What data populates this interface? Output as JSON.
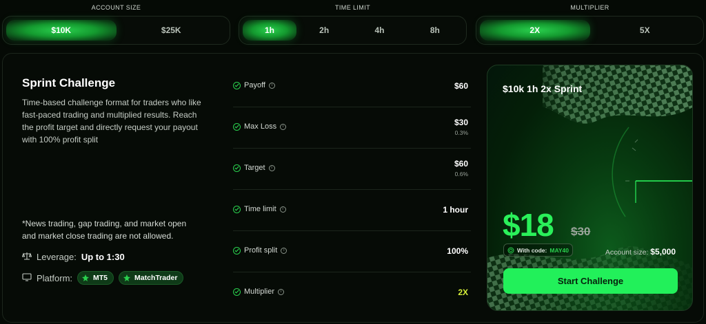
{
  "selectors": {
    "account_size": {
      "label": "ACCOUNT SIZE",
      "options": [
        "$10K",
        "$25K"
      ],
      "selected": "$10K"
    },
    "time_limit": {
      "label": "TIME LIMIT",
      "options": [
        "1h",
        "2h",
        "4h",
        "8h"
      ],
      "selected": "1h"
    },
    "multiplier": {
      "label": "MULTIPLIER",
      "options": [
        "2X",
        "5X"
      ],
      "selected": "2X"
    }
  },
  "challenge": {
    "title": "Sprint Challenge",
    "description": "Time-based challenge format for traders who like fast-paced trading and multiplied results. Reach the profit target and directly request your payout with 100% profit split",
    "note": "*News trading, gap trading, and market open and market close trading are not allowed.",
    "leverage_label": "Leverage:",
    "leverage_value": "Up to 1:30",
    "platform_label": "Platform:",
    "platforms": [
      "MT5",
      "MatchTrader"
    ]
  },
  "stats": [
    {
      "label": "Payoff",
      "value": "$60",
      "sub": ""
    },
    {
      "label": "Max Loss",
      "value": "$30",
      "sub": "0.3%"
    },
    {
      "label": "Target",
      "value": "$60",
      "sub": "0.6%"
    },
    {
      "label": "Time limit",
      "value": "1 hour",
      "sub": ""
    },
    {
      "label": "Profit split",
      "value": "100%",
      "sub": ""
    },
    {
      "label": "Multiplier",
      "value": "2X",
      "sub": ""
    }
  ],
  "promo": {
    "title": "$10k 1h 2x Sprint",
    "price": "$18",
    "old_price": "$30",
    "code_label": "With code:",
    "code_value": "MAY40",
    "account_label": "Account size:",
    "account_value": "$5,000",
    "cta": "Start Challenge"
  },
  "colors": {
    "accent": "#22f05a",
    "multiplier_value": "#d4ee3a",
    "background": "#050a05"
  }
}
